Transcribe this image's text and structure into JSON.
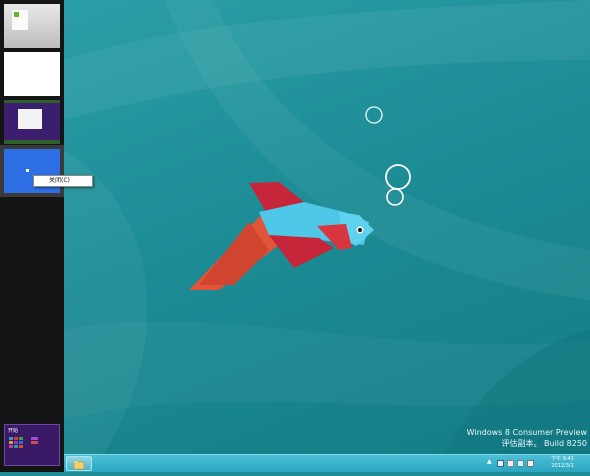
{
  "desktop": {
    "watermark_line1": "Windows 8 Consumer Preview",
    "watermark_line2": "评估副本。 Build 8250"
  },
  "switcher": {
    "context_menu_item": "关闭(C)",
    "start_tile_label": "开始"
  },
  "taskbar": {
    "clock_time": "下午 9:41",
    "clock_date": "2012/3/1",
    "tray_icons": [
      "chevron-up-icon",
      "network-icon",
      "flag-icon",
      "volume-icon",
      "keyboard-icon"
    ]
  },
  "colors": {
    "wallpaper": "#1f8b95",
    "fish_body": "#4fc7e8",
    "fish_red": "#c7263a",
    "fish_orange": "#e0553a",
    "taskbar": "#3bb4cc"
  }
}
